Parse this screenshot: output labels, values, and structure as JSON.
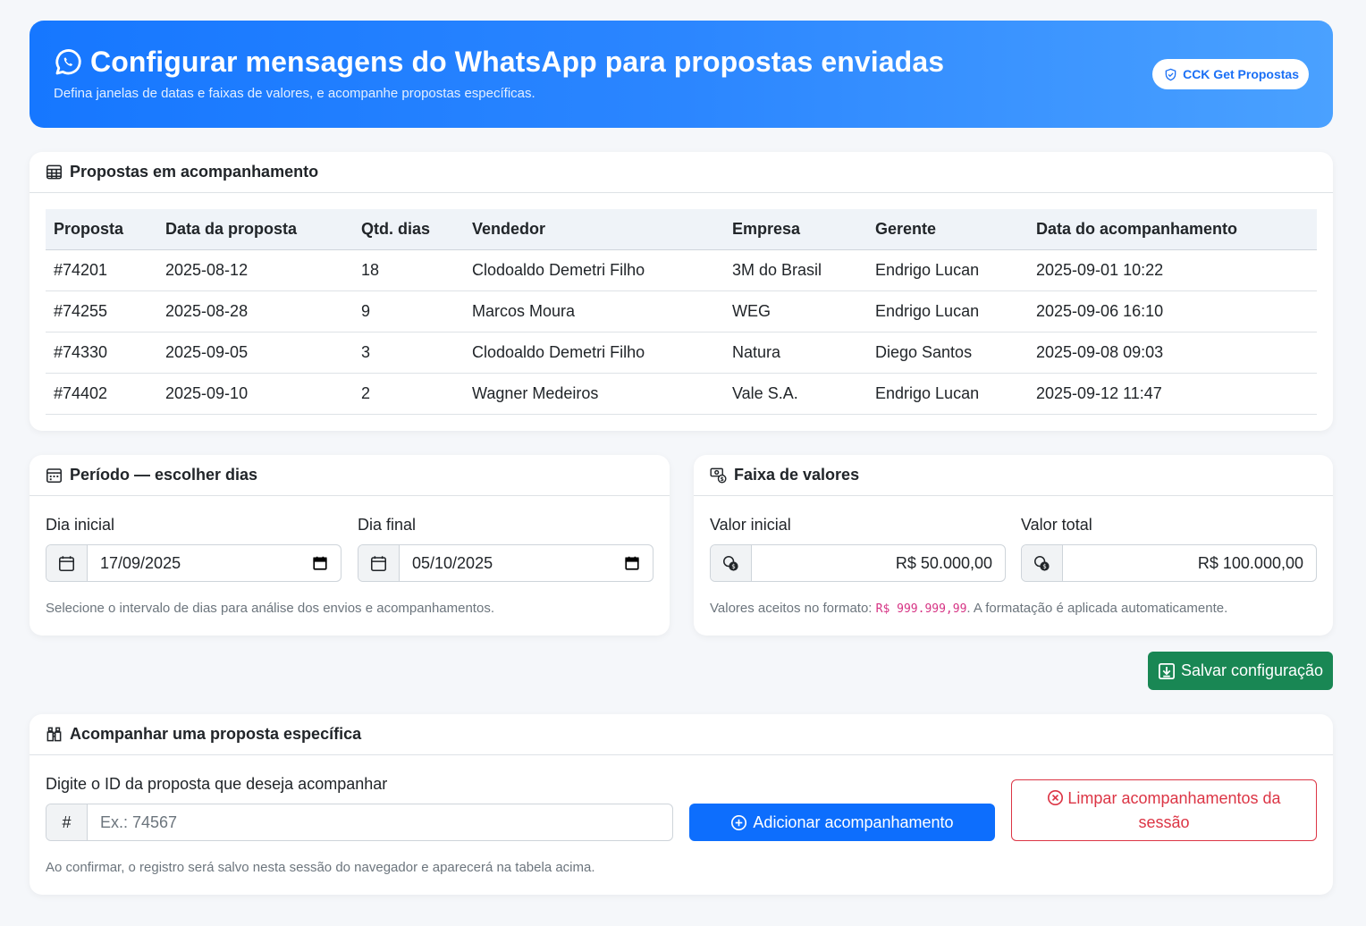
{
  "header": {
    "title": "Configurar mensagens do WhatsApp para propostas enviadas",
    "subtitle": "Defina janelas de datas e faixas de valores, e acompanhe propostas específicas.",
    "badge": "CCK Get Propostas"
  },
  "tracking_table": {
    "title": "Propostas em acompanhamento",
    "columns": [
      "Proposta",
      "Data da proposta",
      "Qtd. dias",
      "Vendedor",
      "Empresa",
      "Gerente",
      "Data do acompanhamento"
    ],
    "rows": [
      [
        "#74201",
        "2025-08-12",
        "18",
        "Clodoaldo Demetri Filho",
        "3M do Brasil",
        "Endrigo Lucan",
        "2025-09-01 10:22"
      ],
      [
        "#74255",
        "2025-08-28",
        "9",
        "Marcos Moura",
        "WEG",
        "Endrigo Lucan",
        "2025-09-06 16:10"
      ],
      [
        "#74330",
        "2025-09-05",
        "3",
        "Clodoaldo Demetri Filho",
        "Natura",
        "Diego Santos",
        "2025-09-08 09:03"
      ],
      [
        "#74402",
        "2025-09-10",
        "2",
        "Wagner Medeiros",
        "Vale S.A.",
        "Endrigo Lucan",
        "2025-09-12 11:47"
      ]
    ]
  },
  "period": {
    "title": "Período — escolher dias",
    "start_label": "Dia inicial",
    "start_value": "17/09/2025",
    "end_label": "Dia final",
    "end_value": "05/10/2025",
    "help": "Selecione o intervalo de dias para análise dos envios e acompanhamentos."
  },
  "values": {
    "title": "Faixa de valores",
    "start_label": "Valor inicial",
    "start_value": "R$ 50.000,00",
    "total_label": "Valor total",
    "total_value": "R$ 100.000,00",
    "help_prefix": "Valores aceitos no formato: ",
    "help_format": "R$ 999.999,99",
    "help_suffix": ". A formatação é aplicada automaticamente."
  },
  "save_button": "Salvar configuração",
  "track": {
    "title": "Acompanhar uma proposta específica",
    "input_label": "Digite o ID da proposta que deseja acompanhar",
    "prefix": "#",
    "placeholder": "Ex.: 74567",
    "add_button": "Adicionar acompanhamento",
    "clear_button": "Limpar acompanhamentos da sessão",
    "help": "Ao confirmar, o registro será salvo nesta sessão do navegador e aparecerá na tabela acima."
  },
  "colors": {
    "primary": "#0d6efd",
    "success": "#198754",
    "danger": "#dc3545",
    "code": "#d63384"
  }
}
